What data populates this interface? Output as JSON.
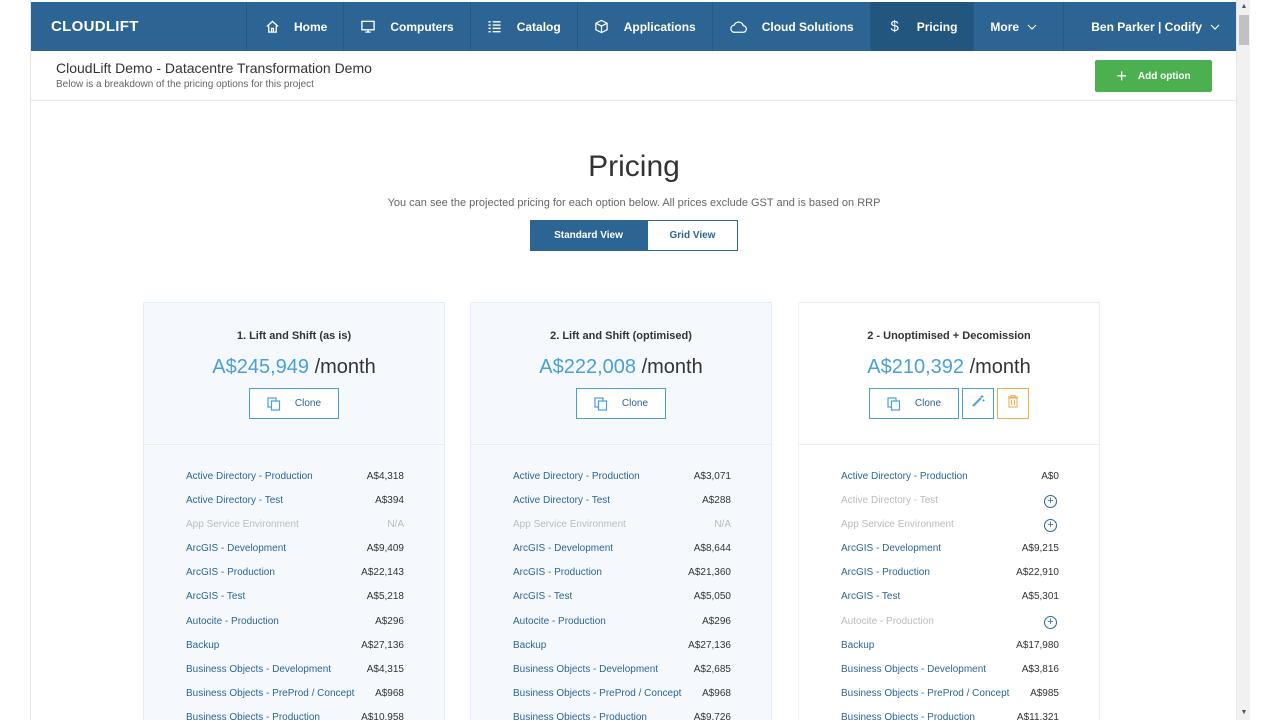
{
  "nav": {
    "brand": "CLOUDLIFT",
    "items": [
      {
        "label": "Home",
        "icon": "home-icon"
      },
      {
        "label": "Computers",
        "icon": "monitor-icon"
      },
      {
        "label": "Catalog",
        "icon": "list-icon"
      },
      {
        "label": "Applications",
        "icon": "cube-icon"
      },
      {
        "label": "Cloud Solutions",
        "icon": "cloud-icon"
      },
      {
        "label": "Pricing",
        "icon": "dollar-icon"
      }
    ],
    "more": "More",
    "user": "Ben Parker | Codify",
    "colors": {
      "bar": "#2c6593",
      "active": "#22567f"
    }
  },
  "header": {
    "title": "CloudLift Demo - Datacentre Transformation Demo",
    "subtitle": "Below is a breakdown of the pricing options for this project",
    "add_label": "Add option",
    "add_color": "#4caf50"
  },
  "pricing": {
    "heading": "Pricing",
    "subtext": "You can see the projected pricing for each option below. All prices exclude GST and is based on RRP",
    "views": [
      "Standard View",
      "Grid View"
    ],
    "per_month": "/month",
    "clone_label": "Clone",
    "accent": "#4a9fd8"
  },
  "options": [
    {
      "title": "1. Lift and Shift (as is)",
      "price": "A$245,949",
      "rows": [
        {
          "label": "Active Directory - Production",
          "value": "A$4,318"
        },
        {
          "label": "Active Directory - Test",
          "value": "A$394"
        },
        {
          "label": "App Service Environment",
          "value": "N/A",
          "dim": true
        },
        {
          "label": "ArcGIS - Development",
          "value": "A$9,409"
        },
        {
          "label": "ArcGIS - Production",
          "value": "A$22,143"
        },
        {
          "label": "ArcGIS - Test",
          "value": "A$5,218"
        },
        {
          "label": "Autocite - Production",
          "value": "A$296"
        },
        {
          "label": "Backup",
          "value": "A$27,136"
        },
        {
          "label": "Business Objects - Development",
          "value": "A$4,315"
        },
        {
          "label": "Business Objects - PreProd / Concept",
          "value": "A$968"
        },
        {
          "label": "Business Objects - Production",
          "value": "A$10,958"
        }
      ]
    },
    {
      "title": "2. Lift and Shift (optimised)",
      "price": "A$222,008",
      "rows": [
        {
          "label": "Active Directory - Production",
          "value": "A$3,071"
        },
        {
          "label": "Active Directory - Test",
          "value": "A$288"
        },
        {
          "label": "App Service Environment",
          "value": "N/A",
          "dim": true
        },
        {
          "label": "ArcGIS - Development",
          "value": "A$8,644"
        },
        {
          "label": "ArcGIS - Production",
          "value": "A$21,360"
        },
        {
          "label": "ArcGIS - Test",
          "value": "A$5,050"
        },
        {
          "label": "Autocite - Production",
          "value": "A$296"
        },
        {
          "label": "Backup",
          "value": "A$27,136"
        },
        {
          "label": "Business Objects - Development",
          "value": "A$2,685"
        },
        {
          "label": "Business Objects - PreProd / Concept",
          "value": "A$968"
        },
        {
          "label": "Business Objects - Production",
          "value": "A$9,726"
        }
      ]
    },
    {
      "title": "2 - Unoptimised + Decomission",
      "price": "A$210,392",
      "rows": [
        {
          "label": "Active Directory - Production",
          "value": "A$0"
        },
        {
          "label": "Active Directory - Test",
          "value": "",
          "dim": true,
          "add": true
        },
        {
          "label": "App Service Environment",
          "value": "",
          "dim": true,
          "add": true
        },
        {
          "label": "ArcGIS - Development",
          "value": "A$9,215"
        },
        {
          "label": "ArcGIS - Production",
          "value": "A$22,910"
        },
        {
          "label": "ArcGIS - Test",
          "value": "A$5,301"
        },
        {
          "label": "Autocite - Production",
          "value": "",
          "dim": true,
          "add": true
        },
        {
          "label": "Backup",
          "value": "A$17,980"
        },
        {
          "label": "Business Objects - Development",
          "value": "A$3,816"
        },
        {
          "label": "Business Objects - PreProd / Concept",
          "value": "A$985"
        },
        {
          "label": "Business Objects - Production",
          "value": "A$11,321"
        }
      ]
    }
  ]
}
